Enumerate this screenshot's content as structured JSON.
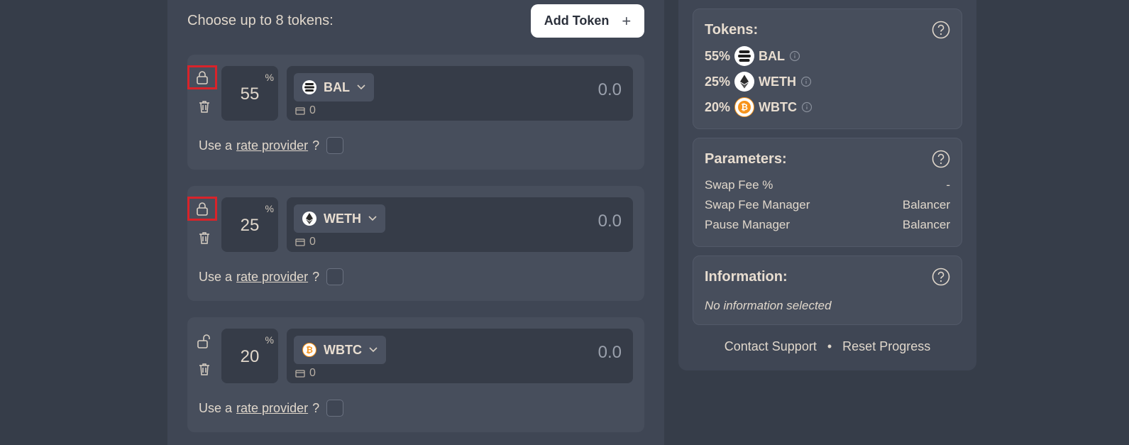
{
  "main": {
    "choose_label": "Choose up to 8 tokens:",
    "add_token_label": "Add Token",
    "add_token_icon": "plus-icon",
    "tokens": [
      {
        "weight": "55",
        "pct": "%",
        "symbol": "BAL",
        "amount": "0.0",
        "balance": "0",
        "locked": true,
        "rate_prefix": "Use a",
        "rate_link": "rate provider",
        "rate_suffix": "?"
      },
      {
        "weight": "25",
        "pct": "%",
        "symbol": "WETH",
        "amount": "0.0",
        "balance": "0",
        "locked": true,
        "rate_prefix": "Use a",
        "rate_link": "rate provider",
        "rate_suffix": "?"
      },
      {
        "weight": "20",
        "pct": "%",
        "symbol": "WBTC",
        "amount": "0.0",
        "balance": "0",
        "locked": false,
        "rate_prefix": "Use a",
        "rate_link": "rate provider",
        "rate_suffix": "?"
      }
    ]
  },
  "sidebar": {
    "tokens_title": "Tokens:",
    "token_summary": [
      {
        "pct": "55%",
        "symbol": "BAL"
      },
      {
        "pct": "25%",
        "symbol": "WETH"
      },
      {
        "pct": "20%",
        "symbol": "WBTC"
      }
    ],
    "parameters_title": "Parameters:",
    "parameters": [
      {
        "label": "Swap Fee %",
        "value": "-"
      },
      {
        "label": "Swap Fee Manager",
        "value": "Balancer"
      },
      {
        "label": "Pause Manager",
        "value": "Balancer"
      }
    ],
    "information_title": "Information:",
    "information_text": "No information selected",
    "contact_support": "Contact Support",
    "separator": "•",
    "reset_progress": "Reset Progress"
  },
  "colors": {
    "background": "#363d49",
    "panel": "#3f4654",
    "card": "#474e5c",
    "highlight": "#d9232a",
    "bitcoin": "#f7931a"
  }
}
